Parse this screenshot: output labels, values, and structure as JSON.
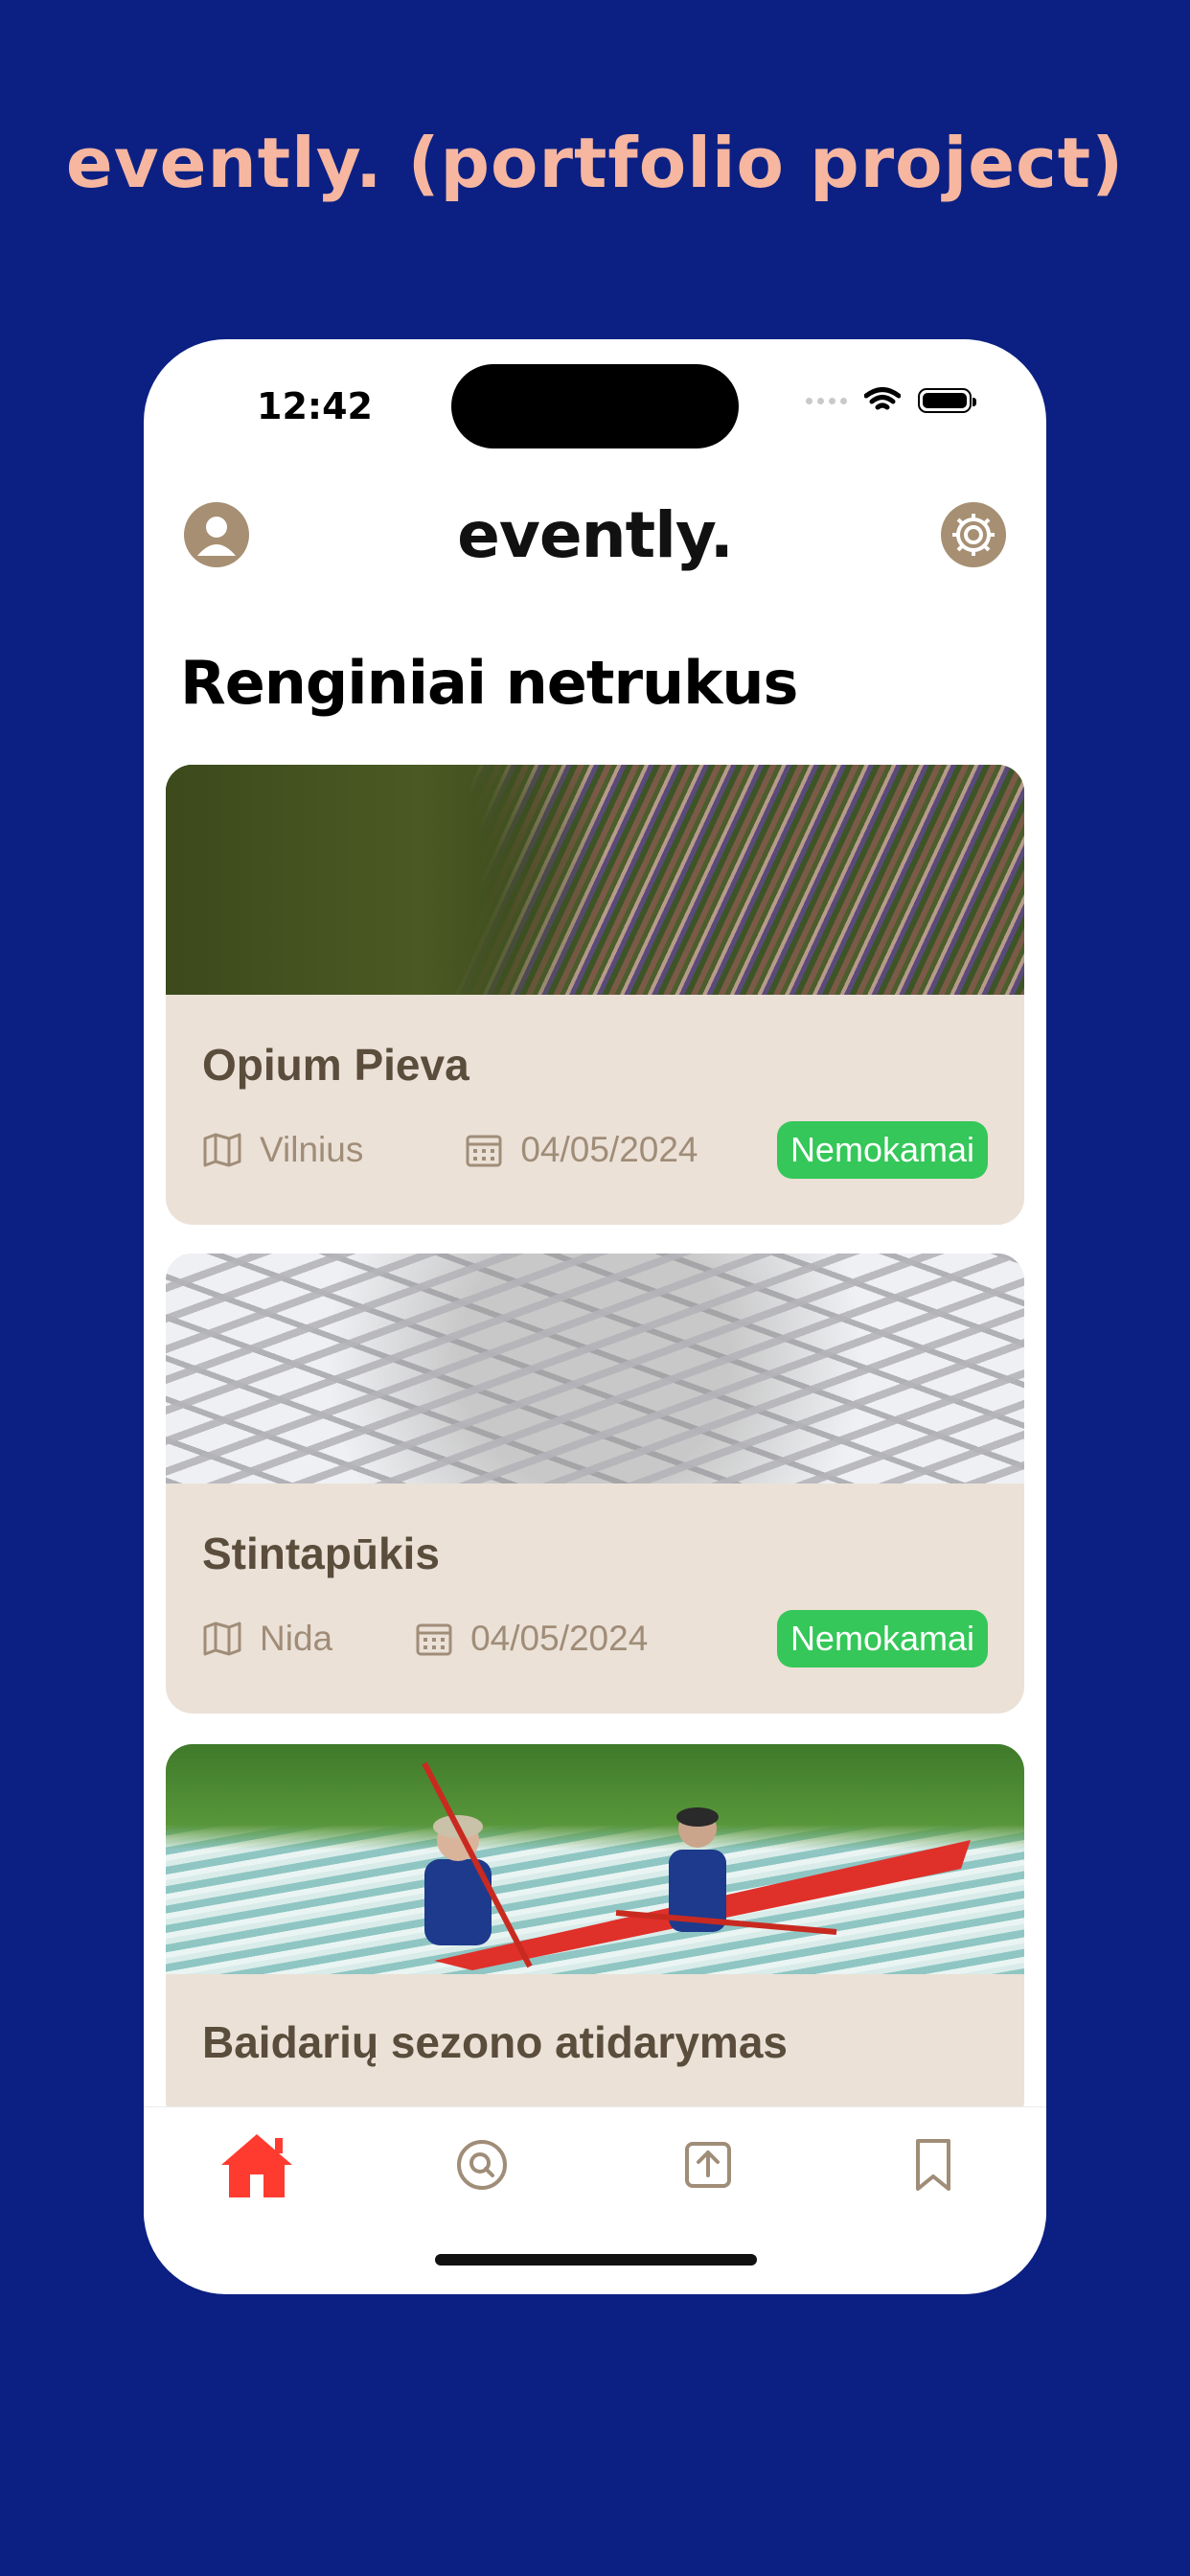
{
  "headline": "evently. (portfolio project)",
  "status_bar": {
    "time": "12:42"
  },
  "header": {
    "logo": "evently.",
    "avatar_icon": "user-icon",
    "settings_icon": "gear-icon"
  },
  "section": {
    "title": "Renginiai netrukus"
  },
  "events": [
    {
      "title": "Opium Pieva",
      "location": "Vilnius",
      "date": "04/05/2024",
      "price": "Nemokamai",
      "image": "crowd-on-meadow"
    },
    {
      "title": "Stintapūkis",
      "location": "Nida",
      "date": "04/05/2024",
      "price": "Nemokamai",
      "image": "fish-on-ice"
    },
    {
      "title": "Baidarių sezono atidarymas",
      "image": "kayakers-on-river"
    }
  ],
  "tabbar": {
    "items": [
      {
        "name": "home",
        "icon": "home-icon",
        "active": true
      },
      {
        "name": "search",
        "icon": "search-icon",
        "active": false
      },
      {
        "name": "upload",
        "icon": "upload-icon",
        "active": false
      },
      {
        "name": "saved",
        "icon": "bookmark-icon",
        "active": false
      }
    ]
  },
  "colors": {
    "background": "#0c2083",
    "accent": "#f6b6a0",
    "card": "#ebe1d7",
    "badge": "#35c759",
    "active_tab": "#ff3b30",
    "icon_brown": "#a68f73"
  }
}
